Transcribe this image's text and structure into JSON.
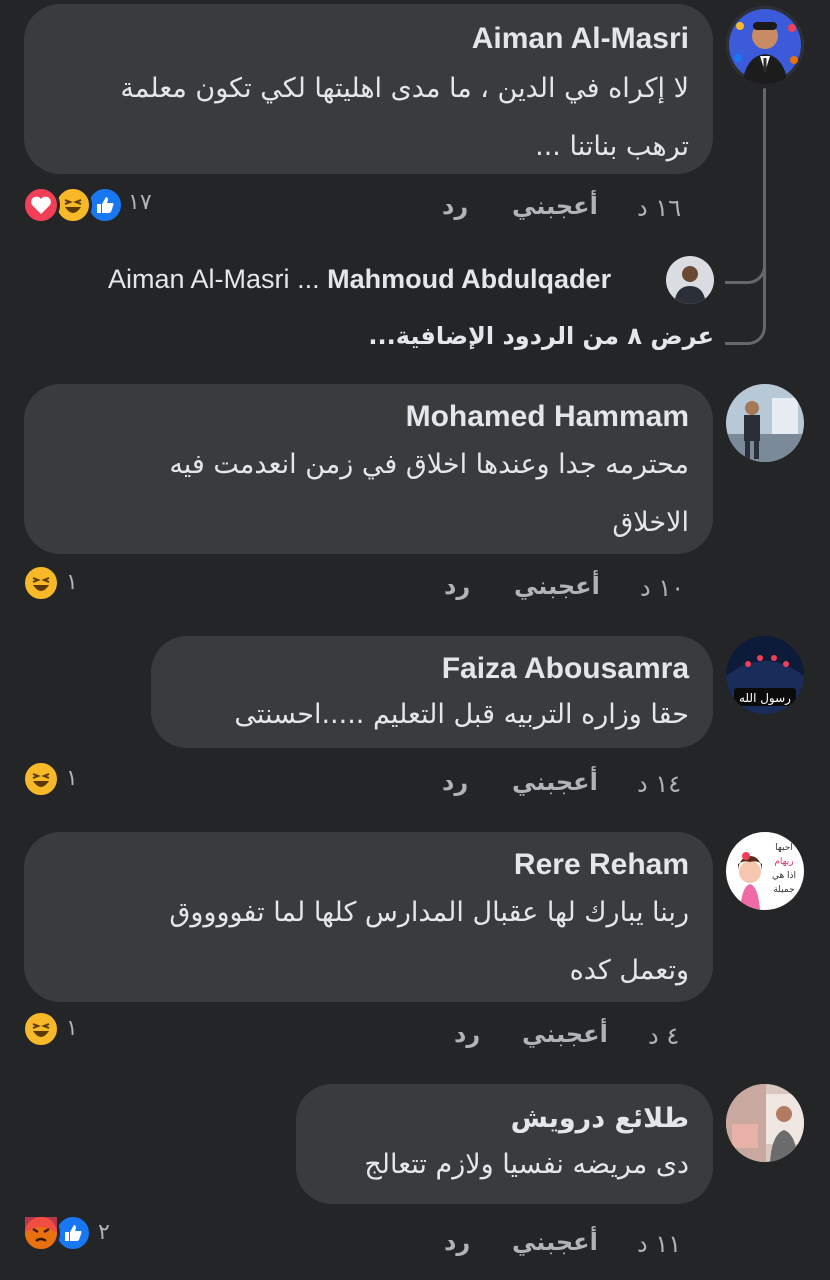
{
  "colors": {
    "background": "#242526",
    "bubble": "#3a3b3c",
    "text": "#e4e6eb",
    "muted": "#b0b3b8",
    "like_blue": "#1877f2",
    "love_red": "#f33e58",
    "haha_yellow": "#f7b928",
    "angry_orange": "#e9710f"
  },
  "comments": [
    {
      "author": "Aiman Al-Masri",
      "text_lines": [
        "لا إكراه في الدين ، ما مدى اهليتها لكي تكون معلمة",
        "ترهب بناتنا ..."
      ],
      "time": "١٦ د",
      "like": "أعجبني",
      "reply": "رد",
      "reaction_count": "١٧",
      "reactions": [
        "love",
        "haha",
        "like"
      ]
    },
    {
      "author": "Mohamed Hammam",
      "text_lines": [
        "محترمه جدا وعندها اخلاق في زمن انعدمت فيه",
        "الاخلاق"
      ],
      "time": "١٠ د",
      "like": "أعجبني",
      "reply": "رد",
      "reaction_count": "١",
      "reactions": [
        "haha"
      ]
    },
    {
      "author": "Faiza Abousamra",
      "text_lines": [
        "حقا وزاره التربيه قبل التعليم .....احسنتى"
      ],
      "time": "١٤ د",
      "like": "أعجبني",
      "reply": "رد",
      "reaction_count": "١",
      "reactions": [
        "haha"
      ]
    },
    {
      "author": "Rere Reham",
      "text_lines": [
        "ربنا يبارك لها عقبال المدارس كلها لما تفووووق",
        "وتعمل كده"
      ],
      "time": "٤ د",
      "like": "أعجبني",
      "reply": "رد",
      "reaction_count": "١",
      "reactions": [
        "haha"
      ]
    },
    {
      "author": "طلائع درويش",
      "text_lines": [
        "دى مريضه نفسيا ولازم تتعالج"
      ],
      "time": "١١ د",
      "like": "أعجبني",
      "reply": "رد",
      "reaction_count": "٢",
      "reactions": [
        "angry",
        "like"
      ]
    }
  ],
  "reply_preview": {
    "author": "Mahmoud Abdulqader",
    "ellipsis": "...",
    "mention": "Aiman Al-Masri"
  },
  "more_replies": "عرض ٨ من الردود الإضافية...",
  "avatar_texts": {
    "rere": [
      "احبها",
      "ريهام",
      "اذا هي",
      "جميلة"
    ],
    "faiza": "رسول الله"
  }
}
